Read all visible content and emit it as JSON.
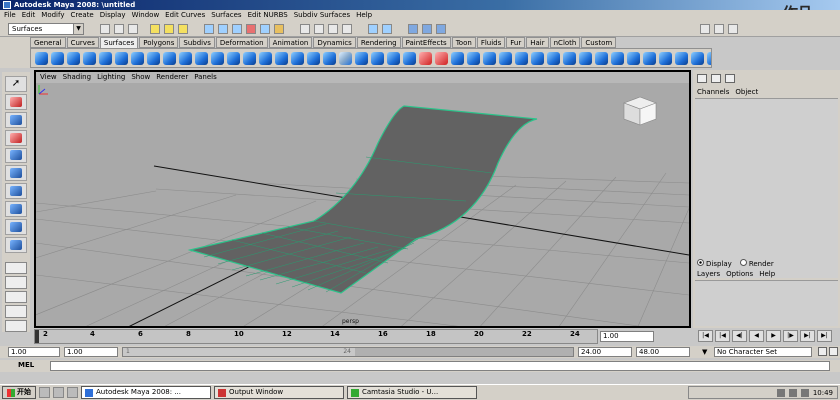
{
  "window": {
    "title": "Autodesk Maya 2008: \\untitled"
  },
  "watermark": "作品",
  "menubar": [
    "File",
    "Edit",
    "Modify",
    "Create",
    "Display",
    "Window",
    "Edit Curves",
    "Surfaces",
    "Edit NURBS",
    "Subdiv Surfaces",
    "Help"
  ],
  "status_line": {
    "mode": "Surfaces"
  },
  "shelf": {
    "tabs": [
      "General",
      "Curves",
      "Surfaces",
      "Polygons",
      "Subdivs",
      "Deformation",
      "Animation",
      "Dynamics",
      "Rendering",
      "PaintEffects",
      "Toon",
      "Fluids",
      "Fur",
      "Hair",
      "nCloth",
      "Custom"
    ],
    "active_tab": "Surfaces"
  },
  "viewport": {
    "panel_menu": [
      "View",
      "Shading",
      "Lighting",
      "Show",
      "Renderer",
      "Panels"
    ],
    "camera_label": "persp"
  },
  "channel_box": {
    "menu": [
      "Channels",
      "Object"
    ],
    "layer_mode": {
      "options": [
        "Display",
        "Render"
      ],
      "selected": "Display"
    },
    "layer_menu": [
      "Layers",
      "Options",
      "Help"
    ]
  },
  "time_slider": {
    "ticks": [
      "2",
      "4",
      "6",
      "8",
      "10",
      "12",
      "14",
      "16",
      "18",
      "20",
      "22",
      "24"
    ],
    "current_frame": "1.00"
  },
  "range_slider": {
    "start_time": "1.00",
    "playback_start": "1.00",
    "handle_start": "1",
    "handle_end": "24",
    "playback_end": "24.00",
    "end_time": "48.00",
    "character_set": "No Character Set"
  },
  "command_line": {
    "label": "MEL"
  },
  "taskbar": {
    "start_label": "开始",
    "tasks": [
      "Autodesk Maya 2008: ...",
      "Output Window",
      "Camtasia Studio - U..."
    ],
    "clock": "10:49"
  }
}
